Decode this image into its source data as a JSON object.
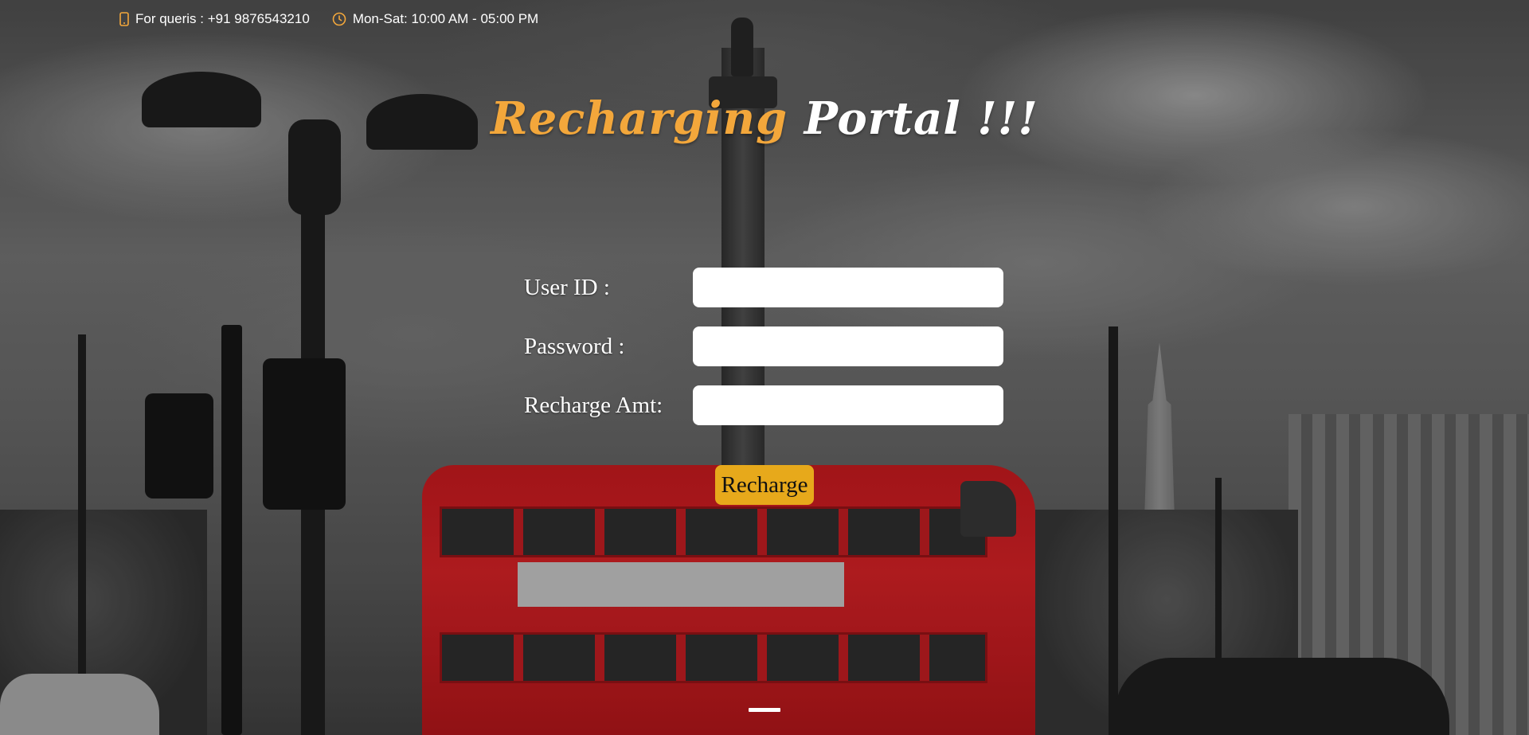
{
  "topbar": {
    "phone_icon": "mobile-phone-icon",
    "phone_text": "For queris : +91 9876543210",
    "clock_icon": "clock-icon",
    "hours_text": "Mon-Sat: 10:00 AM - 05:00 PM",
    "icon_color": "#f3a73b"
  },
  "title": {
    "accent": "Recharging",
    "rest": "Portal !!!",
    "accent_color": "#f3a73b",
    "rest_color": "#ffffff"
  },
  "form": {
    "user_id_label": "User ID :",
    "user_id_value": "",
    "password_label": "Password :",
    "password_value": "",
    "amount_label": "Recharge Amt:",
    "amount_value": ""
  },
  "button": {
    "label": "Recharge",
    "color": "#e7a91b"
  }
}
